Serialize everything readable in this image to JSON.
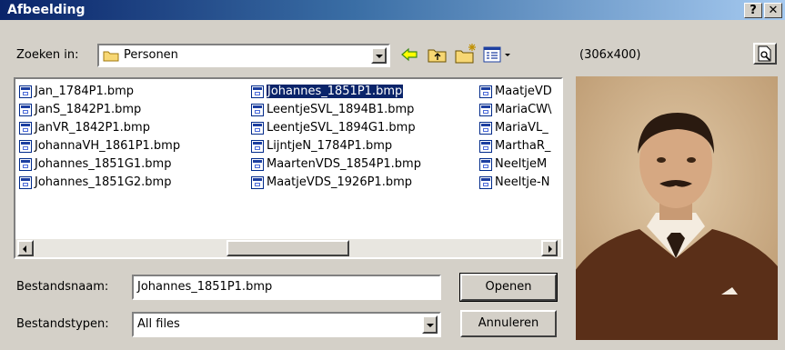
{
  "window": {
    "title": "Afbeelding",
    "help_label": "?",
    "close_label": "✕"
  },
  "toolbar": {
    "look_in_label": "Zoeken in:",
    "look_in_value": "Personen",
    "back_icon": "back-arrow-icon",
    "up_icon": "up-folder-icon",
    "new_folder_icon": "new-folder-icon",
    "view_icon": "view-menu-icon"
  },
  "preview": {
    "size_label": "(306x400)",
    "button_icon": "preview-magnifier-icon"
  },
  "files": {
    "columns": [
      [
        "Jan_1784P1.bmp",
        "JanS_1842P1.bmp",
        "JanVR_1842P1.bmp",
        "JohannaVH_1861P1.bmp",
        "Johannes_1851G1.bmp",
        "Johannes_1851G2.bmp"
      ],
      [
        "Johannes_1851P1.bmp",
        "LeentjeSVL_1894B1.bmp",
        "LeentjeSVL_1894G1.bmp",
        "LijntjeN_1784P1.bmp",
        "MaartenVDS_1854P1.bmp",
        "MaatjeVDS_1926P1.bmp"
      ],
      [
        "MaatjeVD",
        "MariaCW\\",
        "MariaVL_",
        "MarthaR_",
        "NeeltjeM",
        "Neeltje-N"
      ]
    ],
    "selected": "Johannes_1851P1.bmp"
  },
  "filename": {
    "label": "Bestandsnaam:",
    "value": "Johannes_1851P1.bmp"
  },
  "filetype": {
    "label": "Bestandstypen:",
    "value": "All files"
  },
  "buttons": {
    "open": "Openen",
    "cancel": "Annuleren"
  }
}
